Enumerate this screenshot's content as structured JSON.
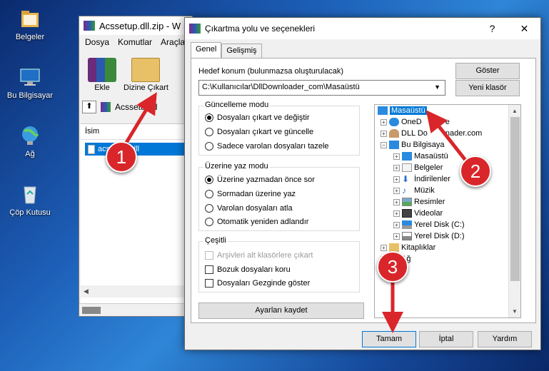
{
  "desktop": {
    "icons": [
      {
        "label": "Belgeler"
      },
      {
        "label": "Bu Bilgisayar"
      },
      {
        "label": "Ağ"
      },
      {
        "label": "Çöp Kutusu"
      }
    ]
  },
  "winrar": {
    "title": "Acssetup.dll.zip - W",
    "menu": [
      "Dosya",
      "Komutlar",
      "Araçla"
    ],
    "toolbar": {
      "add": "Ekle",
      "extract": "Dizine Çıkart"
    },
    "address": "Acssetup.d",
    "column_name": "İsim",
    "file": "acssetup.dll"
  },
  "dialog": {
    "title": "Çıkartma yolu ve seçenekleri",
    "help": "?",
    "close": "✕",
    "tabs": [
      "Genel",
      "Gelişmiş"
    ],
    "dest_label": "Hedef konum (bulunmazsa oluşturulacak)",
    "dest_value": "C:\\Kullanıcılar\\DllDownloader_com\\Masaüstü",
    "show_button": "Göster",
    "new_folder_button": "Yeni klasör",
    "update_mode": {
      "title": "Güncelleme modu",
      "options": [
        "Dosyaları çıkart ve değiştir",
        "Dosyaları çıkart ve güncelle",
        "Sadece varolan dosyaları tazele"
      ],
      "selected": 0
    },
    "overwrite_mode": {
      "title": "Üzerine yaz modu",
      "options": [
        "Üzerine yazmadan önce sor",
        "Sormadan üzerine yaz",
        "Varolan dosyaları atla",
        "Otomatik yeniden adlandır"
      ],
      "selected": 0
    },
    "misc": {
      "title": "Çeşitli",
      "options": [
        "Arşivleri alt klasörlere çıkart",
        "Bozuk dosyaları koru",
        "Dosyaları Gezginde göster"
      ]
    },
    "save_settings_button": "Ayarları kaydet",
    "tree": [
      {
        "label": "Masaüstü",
        "selected": true
      },
      {
        "label": "OneD"
      },
      {
        "label": "DLL Do"
      },
      {
        "label": "Bu Bilgisaya"
      },
      {
        "label": "Masaüstü"
      },
      {
        "label": "Belgeler"
      },
      {
        "label": "İndirilenler"
      },
      {
        "label": "Müzik"
      },
      {
        "label": "Resimler"
      },
      {
        "label": "Videolar"
      },
      {
        "label": "Yerel Disk (C:)"
      },
      {
        "label": "Yerel Disk (D:)"
      },
      {
        "label": "Kitaplıklar"
      },
      {
        "label": "Ağ"
      }
    ],
    "tree_partial": {
      "onedrive_tail": "e",
      "dll_tail": "nader.com"
    },
    "ok_button": "Tamam",
    "cancel_button": "İptal",
    "help_button": "Yardım"
  },
  "annotations": [
    "1",
    "2",
    "3"
  ],
  "colors": {
    "accent": "#0078d7",
    "annotation": "#d9262a"
  }
}
